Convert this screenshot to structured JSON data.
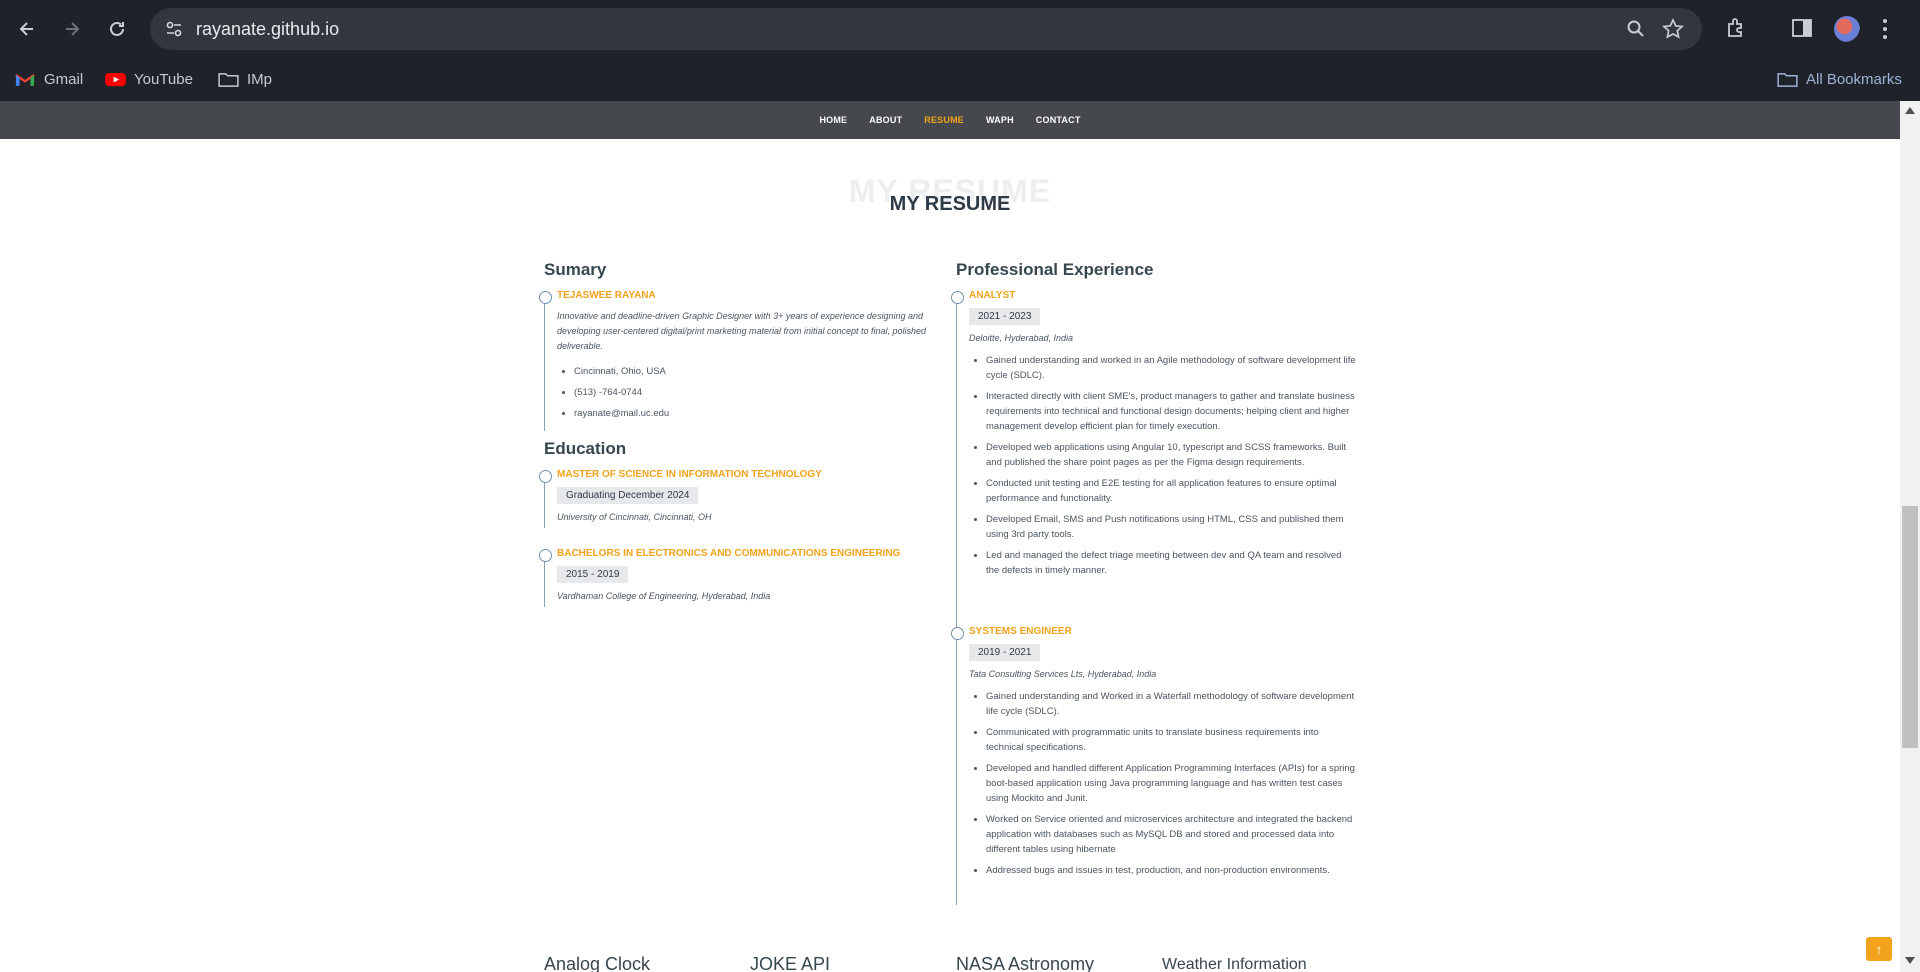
{
  "browser": {
    "url": "rayanate.github.io",
    "bookmarks": [
      {
        "label": "Gmail",
        "icon": "gmail-icon"
      },
      {
        "label": "YouTube",
        "icon": "youtube-icon"
      },
      {
        "label": "IMp",
        "icon": "folder-icon"
      }
    ],
    "all_bookmarks": "All Bookmarks"
  },
  "site_nav": {
    "items": [
      "HOME",
      "ABOUT",
      "RESUME",
      "WAPH",
      "CONTACT"
    ],
    "active": "RESUME",
    "accent": "#f2a31b"
  },
  "resume": {
    "bg_title": "MY RESUME",
    "title": "MY RESUME",
    "summary": {
      "heading": "Sumary",
      "name": "TEJASWEE RAYANA",
      "description": "Innovative and deadline-driven Graphic Designer with 3+ years of experience designing and developing user-centered digital/print marketing material from initial concept to final, polished deliverable.",
      "contacts": [
        "Cincinnati, Ohio, USA",
        "(513) -764-0744",
        "rayanate@mail.uc.edu"
      ]
    },
    "education": {
      "heading": "Education",
      "items": [
        {
          "title": "MASTER OF SCIENCE IN INFORMATION TECHNOLOGY",
          "date": "Graduating December 2024",
          "place": "University of Cincinnati, Cincinnati, OH"
        },
        {
          "title": "BACHELORS IN ELECTRONICS AND COMMUNICATIONS ENGINEERING",
          "date": "2015 - 2019",
          "place": "Vardhaman College of Engineering, Hyderabad, India"
        }
      ]
    },
    "experience": {
      "heading": "Professional Experience",
      "items": [
        {
          "title": "ANALYST",
          "date": "2021 - 2023",
          "place": "Deloitte, Hyderabad, India",
          "bullets": [
            "Gained understanding and worked in an Agile methodology of software development life cycle (SDLC).",
            "Interacted directly with client SME's, product managers to gather and translate business requirements into technical and functional design documents; helping client and higher management develop efficient plan for timely execution.",
            "Developed web applications using Angular 10, typescript and SCSS frameworks. Built and published the share point pages as per the Figma design requirements.",
            "Conducted unit testing and E2E testing for all application features to ensure optimal performance and functionality.",
            "Developed Email, SMS and Push notifications using HTML, CSS and published them using 3rd party tools.",
            "Led and managed the defect triage meeting between dev and QA team and resolved the defects in timely manner."
          ]
        },
        {
          "title": "SYSTEMS ENGINEER",
          "date": "2019 - 2021",
          "place": "Tata Consulting Services Lts, Hyderabad, India",
          "bullets": [
            "Gained understanding and Worked in a Waterfall methodology of software development life cycle (SDLC).",
            "Communicated with programmatic units to translate business requirements into technical specifications.",
            "Developed and handled different Application Programming Interfaces (APIs) for a spring boot-based application using Java programming language and has written test cases using Mockito and Junit.",
            "Worked on Service oriented and microservices architecture and integrated the backend application with databases such as MySQL DB and stored and processed data into different tables using hibernate",
            "Addressed bugs and issues in test, production, and non-production environments."
          ]
        }
      ]
    }
  },
  "bottom_sections": [
    "Analog Clock",
    "JOKE API",
    "NASA Astronomy",
    "Weather Information"
  ]
}
